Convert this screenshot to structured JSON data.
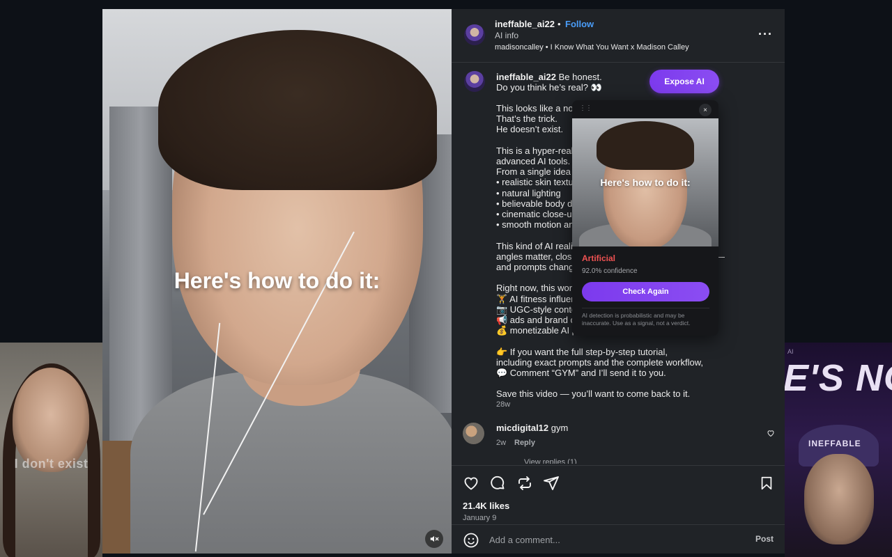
{
  "background": {
    "left_thumb_caption": "I don't exist",
    "right_thumb_top_text": "E'S NOT",
    "right_thumb_small_label": "AI",
    "right_thumb_cap_word": "INEFFABLE"
  },
  "video": {
    "caption": "Here's how to do it:",
    "mute_icon": "speaker-muted-icon"
  },
  "post": {
    "header": {
      "username": "ineffable_ai22",
      "separator": "•",
      "follow_label": "Follow",
      "ai_info": "AI info",
      "audio": "madisoncalley • I Know What You Want x Madison Calley",
      "more_icon": "···"
    },
    "caption": {
      "username": "ineffable_ai22",
      "first_line": "Be honest.",
      "second_line": "Do you think he’s real? 👀",
      "body": "This looks like a normal gym video.\nThat’s the trick.\nHe doesn’t exist.\n\nThis is a hyper-realistic AI influencer created using\nadvanced AI tools.\nFrom a single idea to:\n• realistic skin texture\n• natural lighting\n• believable body details\n• cinematic close-ups\n• smooth motion and camera angles\n\nThis kind of AI realism is possible when camera\nangles matter, close-ups are intentional, details matter —\nand prompts change everything.\n\nRight now, this workflow is used for:\n🏋 AI fitness influencers\n📷 UGC-style content\n📢 ads and brand campaigns\n💰 monetizable AI projects\n\n👉 If you want the full step-by-step tutorial,\nincluding exact prompts and the complete workflow,\n💬 Comment “GYM” and I’ll send it to you.\n\nSave this video — you’ll want to come back to it.",
      "time": "28w"
    },
    "comment": {
      "username": "micdigital12",
      "text": "gym",
      "time": "2w",
      "reply_label": "Reply",
      "view_replies": "View replies (1)"
    },
    "likes": "21.4K likes",
    "date": "January 9",
    "comment_placeholder": "Add a comment...",
    "post_label": "Post"
  },
  "expose_button": "Expose AI",
  "detector": {
    "drag_handle": "⋮⋮",
    "close": "×",
    "thumb_caption": "Here's how to do it:",
    "verdict": "Artificial",
    "confidence": "92.0% confidence",
    "check_again": "Check Again",
    "disclaimer": "AI detection is probabilistic and may be inaccurate. Use as a signal, not a verdict.",
    "verdict_color": "#f05252",
    "accent": "#7c3aed"
  }
}
